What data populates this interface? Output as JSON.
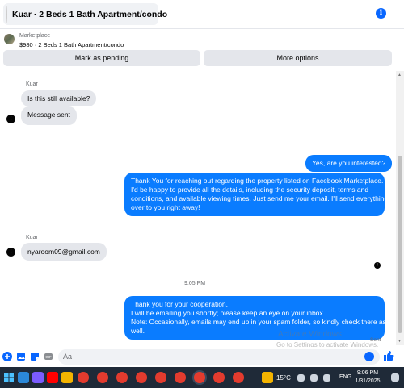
{
  "header": {
    "title": "Kuar · 2 Beds 1 Bath Apartment/condo",
    "info_icon": "info-icon",
    "info_glyph": "i"
  },
  "listing": {
    "label": "Marketplace",
    "summary": "$980 · 2 Beds 1 Bath Apartment/condo"
  },
  "actions": {
    "mark_pending": "Mark as pending",
    "more_options": "More options"
  },
  "chat": {
    "sender_1": "Kuar",
    "msg_1": "Is this still available?",
    "msg_2": "Message sent",
    "out_1": "Yes, are you interested?",
    "out_2_lines": [
      "Thank You for reaching out regarding the property listed on Facebook Marketplace.",
      "I'd be happy to provide all the details, including the security deposit, terms and",
      "conditions, and available viewing times. Just send me your email. I'll send everything",
      "over to you right away!"
    ],
    "sender_2": "Kuar",
    "msg_3": "nyaroom09@gmail.com",
    "time_divider": "9:05 PM",
    "out_3_lines": [
      "Thank you for your cooperation.",
      "I will be emailing you shortly; please keep an eye on your inbox.",
      "Note: Occasionally, emails may end up in your spam folder, so kindly check there as",
      "well."
    ],
    "status": "Sent",
    "alert_glyph": "!"
  },
  "watermark": {
    "line1": "Activate Windows",
    "line2": "Go to Settings to activate Windows."
  },
  "composer": {
    "placeholder": "Aa"
  },
  "taskbar": {
    "weather": "15°C",
    "lang": "ENG",
    "time": "9:06 PM",
    "date": "1/31/2025"
  },
  "colors": {
    "accent": "#0866ff",
    "outgoing_bubble": "#0a7cff",
    "incoming_bubble": "#e4e6eb",
    "taskbar": "#1f2a38"
  }
}
